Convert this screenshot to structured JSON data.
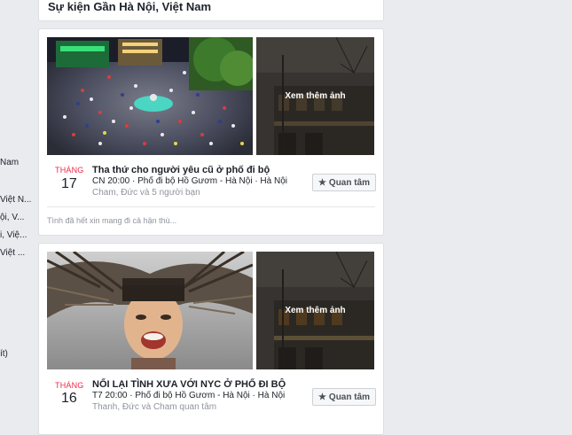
{
  "sidebar": {
    "items": [
      "Nam",
      "Việt N...",
      "ội, V...",
      "i, Việ...",
      "Việt ...",
      "ít)"
    ]
  },
  "section": {
    "title": "Sự kiện Gần Hà Nội, Việt Nam"
  },
  "events": [
    {
      "month": "THÁNG",
      "day": "17",
      "title": "Tha thứ cho người yêu cũ ở phố đi bộ",
      "info": "CN 20:00 · Phố đi bộ Hồ Gươm - Hà Nội · Hà Nội",
      "friends": "Cham, Đức và 5 người bạn",
      "button_label": "Quan tâm",
      "see_more": "Xem thêm ảnh",
      "post_snippet": "Tình đã hết xin mang đi cả hận thù..."
    },
    {
      "month": "THÁNG",
      "day": "16",
      "title": "NỐI LẠI TÌNH XƯA VỚI NYC Ở PHỐ ĐI BỘ",
      "info": "T7 20:00 · Phố đi bộ Hồ Gươm - Hà Nội · Hà Nội",
      "friends": "Thanh, Đức và Cham quan tâm",
      "button_label": "Quan tâm",
      "see_more": "Xem thêm ảnh"
    }
  ],
  "icons": {
    "interested": "star-icon"
  },
  "colors": {
    "month": "#f02849",
    "background": "#e9ebee"
  }
}
